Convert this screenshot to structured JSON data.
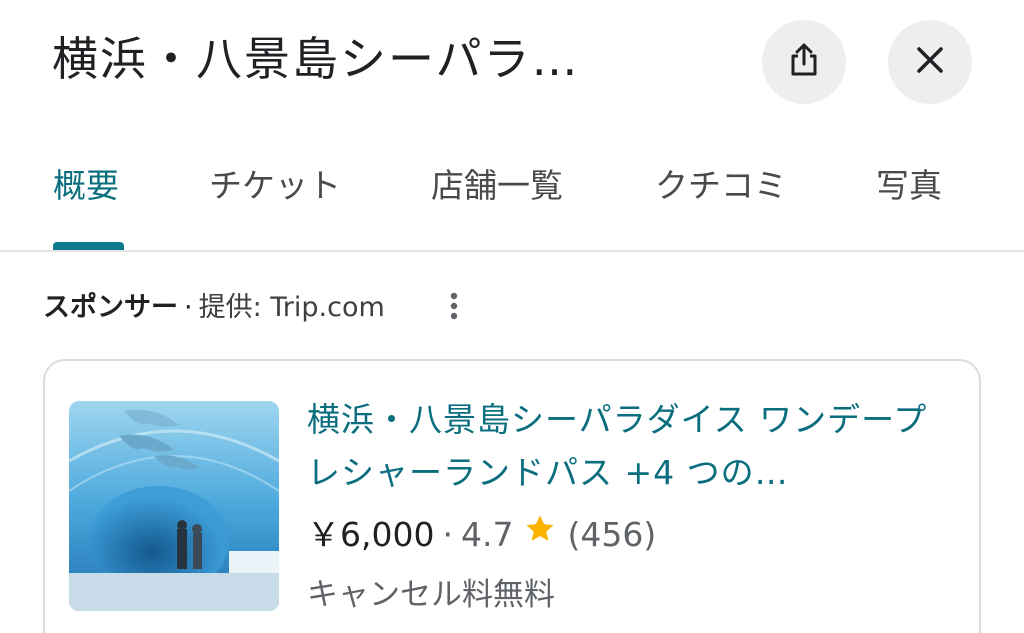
{
  "header": {
    "title": "横浜・八景島シーパラ…"
  },
  "tabs": [
    {
      "label": "概要",
      "active": true
    },
    {
      "label": "チケット",
      "active": false
    },
    {
      "label": "店舗一覧",
      "active": false
    },
    {
      "label": "クチコミ",
      "active": false
    },
    {
      "label": "写真",
      "active": false
    }
  ],
  "sponsor": {
    "label": "スポンサー",
    "separator": "·",
    "provider": "提供: Trip.com"
  },
  "listing": {
    "title": "横浜・八景島シーパラダイス ワンデープレシャーランドパス +4 つの…",
    "price": "￥6,000",
    "separator": "·",
    "rating": "4.7",
    "reviews": "(456)",
    "note": "キャンセル料無料"
  },
  "colors": {
    "accent": "#0b6e7f",
    "star": "#f9b400",
    "button_bg": "#eeeeee"
  },
  "icons": {
    "share": "share-icon",
    "close": "close-icon",
    "more": "more-vert-icon",
    "star": "star-icon"
  }
}
